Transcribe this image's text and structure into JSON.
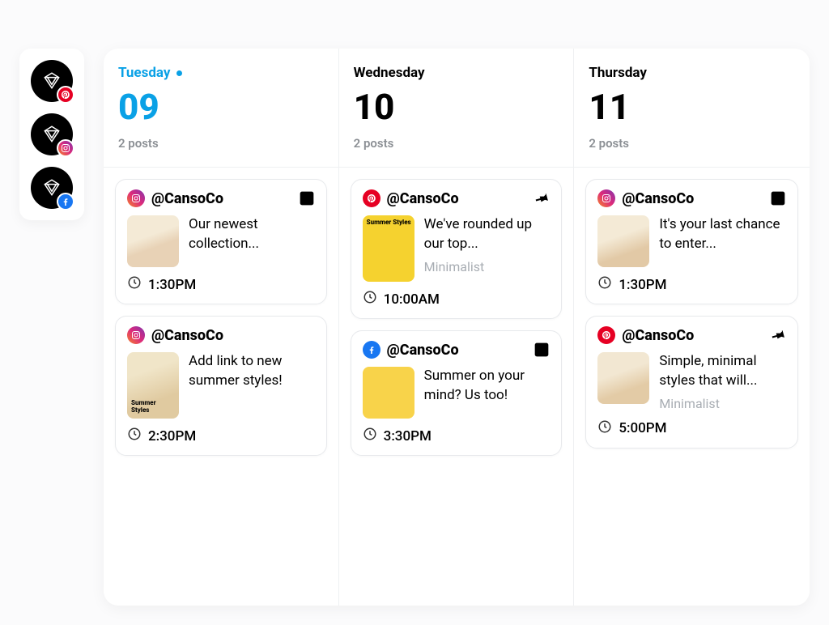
{
  "accounts": [
    {
      "network": "pinterest"
    },
    {
      "network": "instagram"
    },
    {
      "network": "facebook"
    }
  ],
  "days": [
    {
      "name": "Tuesday",
      "active": true,
      "num": "09",
      "count": "2 posts",
      "posts": [
        {
          "network": "instagram",
          "handle": "@CansoCo",
          "icon": "grid",
          "caption": "Our newest collection...",
          "time": "1:30PM",
          "thumb": "ph1 sq"
        },
        {
          "network": "instagram",
          "handle": "@CansoCo",
          "icon": "",
          "caption": "Add link to new summer styles!",
          "thumbLabel": "Summer\nStyles",
          "time": "2:30PM",
          "thumb": "ph2"
        }
      ]
    },
    {
      "name": "Wednesday",
      "active": false,
      "num": "10",
      "count": "2 posts",
      "posts": [
        {
          "network": "pinterest",
          "handle": "@CansoCo",
          "icon": "pin",
          "caption": "We've rounded up our top...",
          "board": "Minimalist",
          "thumbLabelTop": "Summer Styles",
          "time": "10:00AM",
          "thumb": "ph3"
        },
        {
          "network": "facebook",
          "handle": "@CansoCo",
          "icon": "grid",
          "caption": "Summer on your mind? Us too!",
          "time": "3:30PM",
          "thumb": "ph4 sq"
        }
      ]
    },
    {
      "name": "Thursday",
      "active": false,
      "num": "11",
      "count": "2 posts",
      "posts": [
        {
          "network": "instagram",
          "handle": "@CansoCo",
          "icon": "grid",
          "caption": "It's your last chance to enter...",
          "time": "1:30PM",
          "thumb": "ph5 sq"
        },
        {
          "network": "pinterest",
          "handle": "@CansoCo",
          "icon": "pin",
          "caption": "Simple, minimal styles that will...",
          "board": "Minimalist",
          "time": "5:00PM",
          "thumb": "ph6 sq"
        }
      ]
    }
  ]
}
